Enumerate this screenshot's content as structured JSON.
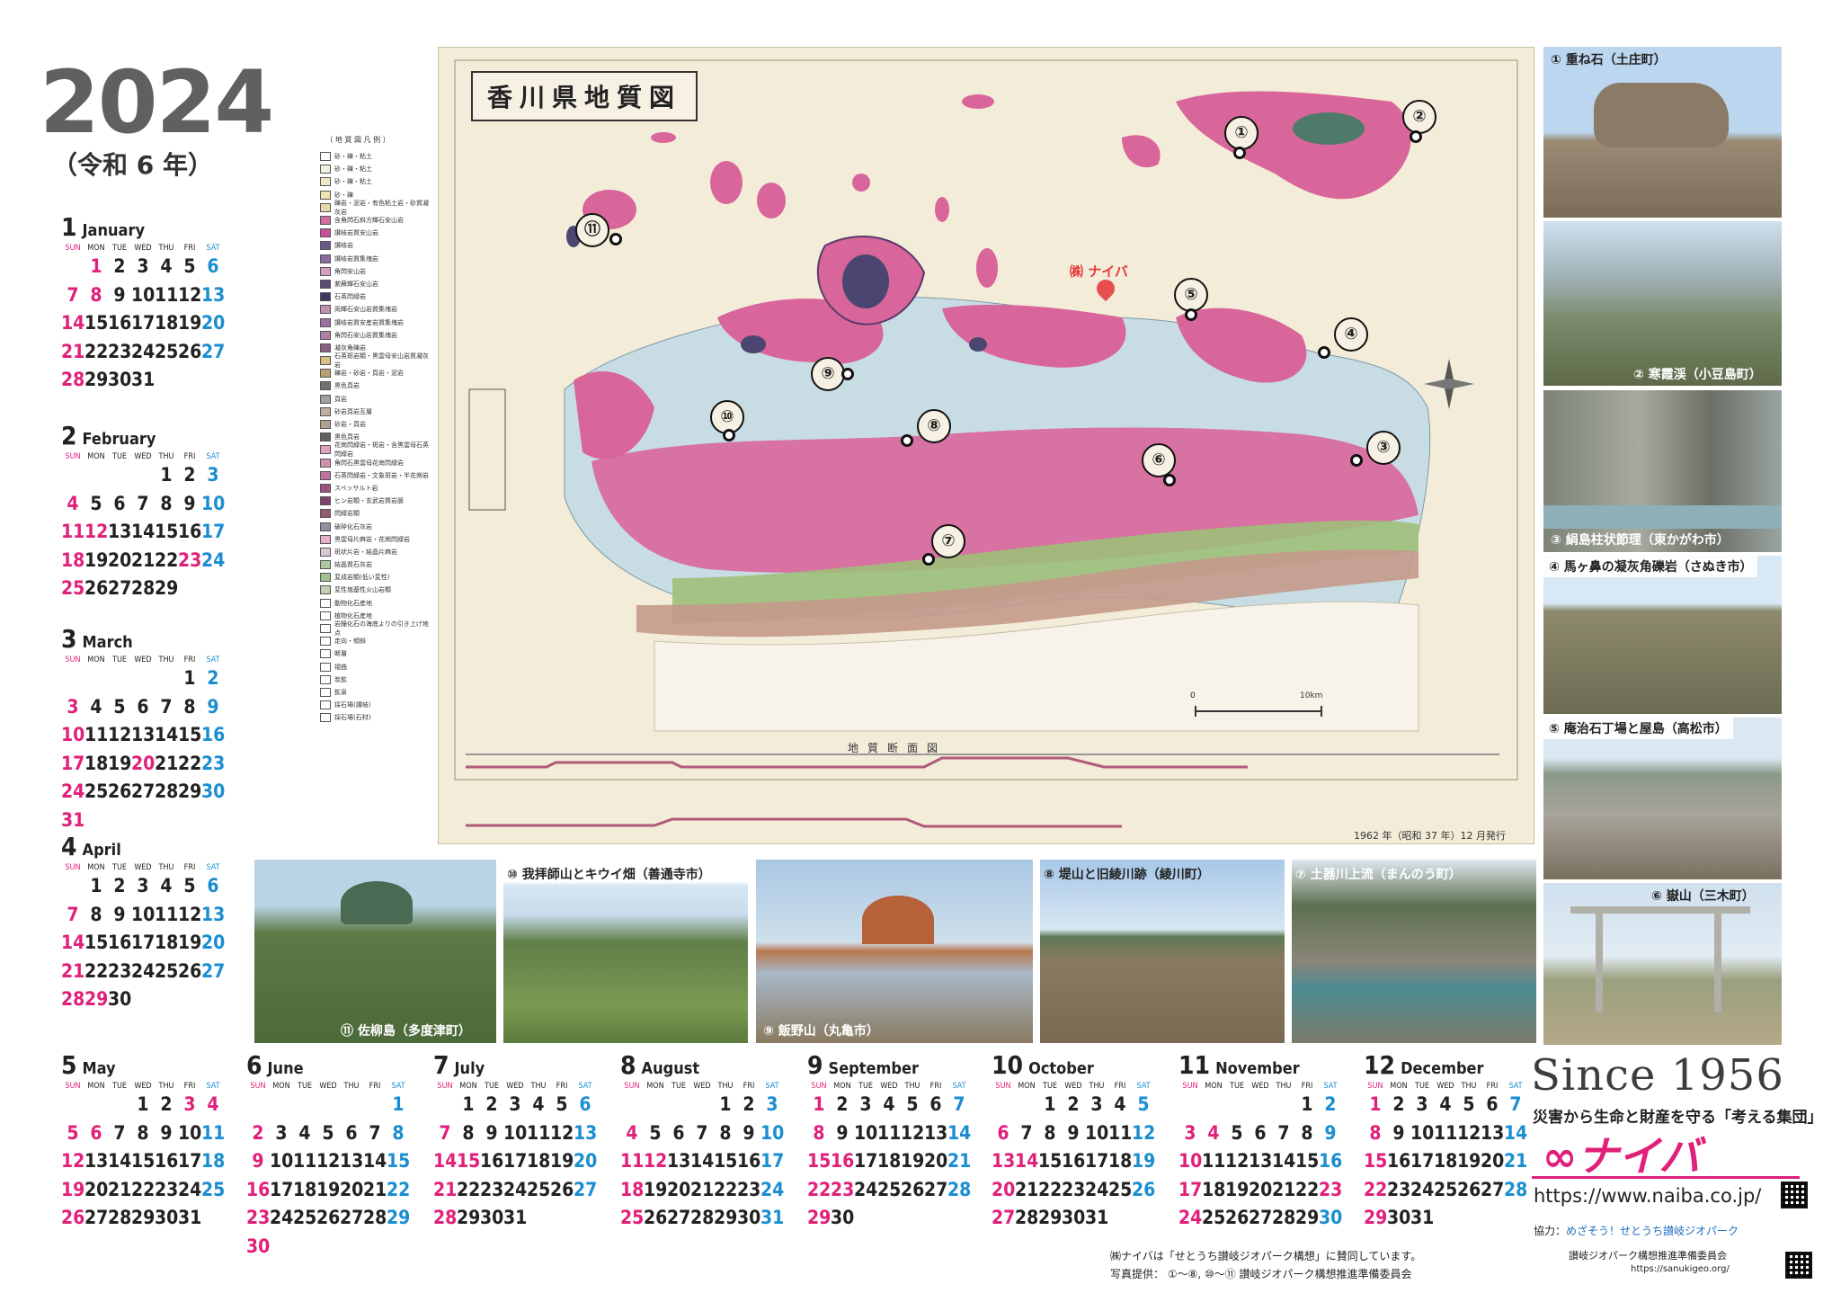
{
  "header": {
    "year": "2024",
    "era": "（令和 6 年）"
  },
  "weekday_labels": [
    "SUN",
    "MON",
    "TUE",
    "WED",
    "THU",
    "FRI",
    "SAT"
  ],
  "months": [
    {
      "num": "1",
      "name": "January",
      "start": 1,
      "days": 31,
      "holidays": [
        1,
        8
      ]
    },
    {
      "num": "2",
      "name": "February",
      "start": 4,
      "days": 29,
      "holidays": [
        11,
        12,
        23
      ]
    },
    {
      "num": "3",
      "name": "March",
      "start": 5,
      "days": 31,
      "holidays": [
        20
      ]
    },
    {
      "num": "4",
      "name": "April",
      "start": 1,
      "days": 30,
      "holidays": [
        29
      ]
    },
    {
      "num": "5",
      "name": "May",
      "start": 3,
      "days": 31,
      "holidays": [
        3,
        4,
        5,
        6
      ]
    },
    {
      "num": "6",
      "name": "June",
      "start": 6,
      "days": 30,
      "holidays": []
    },
    {
      "num": "7",
      "name": "July",
      "start": 1,
      "days": 31,
      "holidays": [
        15
      ]
    },
    {
      "num": "8",
      "name": "August",
      "start": 4,
      "days": 31,
      "holidays": [
        11,
        12
      ]
    },
    {
      "num": "9",
      "name": "September",
      "start": 0,
      "days": 30,
      "holidays": [
        16,
        22,
        23
      ]
    },
    {
      "num": "10",
      "name": "October",
      "start": 2,
      "days": 31,
      "holidays": [
        14
      ]
    },
    {
      "num": "11",
      "name": "November",
      "start": 5,
      "days": 30,
      "holidays": [
        3,
        4,
        23
      ]
    },
    {
      "num": "12",
      "name": "December",
      "start": 0,
      "days": 31,
      "holidays": []
    }
  ],
  "map": {
    "title": "香川県地質図",
    "naiba_label": "㈱ ナイバ",
    "section_title": "地質断面図",
    "scale_zero": "0",
    "scale_label": "10km",
    "issued": "1962 年（昭和 37 年）12 月発行",
    "markers": [
      "①",
      "②",
      "③",
      "④",
      "⑤",
      "⑥",
      "⑦",
      "⑧",
      "⑨",
      "⑩",
      "⑪"
    ]
  },
  "legend": {
    "title": "〔 地 質 図 凡 例 〕",
    "items": [
      "砂・礫・粘土",
      "砂・礫・粘土",
      "砂・礫・粘土",
      "砂・礫",
      "礫岩・泥岩・有色粘土岩・砂質凝灰岩",
      "含角閃石斜方輝石安山岩",
      "讃岐岩質安山岩",
      "讃岐岩",
      "讃岐岩質集塊岩",
      "角閃安山岩",
      "紫蘇輝石安山岩",
      "石英閃緑岩",
      "両輝石安山岩質集塊岩",
      "讃岐岩質安産岩質集塊岩",
      "角閃石安山岩質集塊岩",
      "凝灰角礫岩",
      "石英斑岩類・黒雲母安山岩質凝灰岩",
      "礫岩・砂岩・頁岩・泥岩",
      "黒色頁岩",
      "頁岩",
      "砂岩頁岩互層",
      "砂岩・頁岩",
      "黒色頁岩",
      "花崗閃緑岩・斑岩・含黒雲母石英閃緑岩",
      "角閃石黒雲母花崗閃緑岩",
      "石英閃緑岩・文象斑岩・半花崗岩",
      "スペッサルト岩",
      "ヒン岩類・玄武岩質岩脈",
      "閃緑岩類",
      "破砕化石灰岩",
      "黒雲母片麻岩・花崗閃緑岩",
      "斑状片岩・結晶片麻岩",
      "結晶質石灰岩",
      "変成岩類(低い変性)",
      "変性塩基性火山岩類",
      "動物化石産地",
      "植物化石産地",
      "岩鐘化石の海底よりの引き上げ地点",
      "走向・傾斜",
      "断層",
      "褶曲",
      "炭鉱",
      "鉱泉",
      "採石場(讃岐)",
      "採石場(石材)"
    ]
  },
  "photos": {
    "p1": "① 重ね石（土庄町）",
    "p2": "② 寒霞渓（小豆島町）",
    "p3": "③ 絹島柱状節理（東かがわ市）",
    "p4": "④ 馬ヶ鼻の凝灰角礫岩（さぬき市）",
    "p5": "⑤ 庵治石丁場と屋島（高松市）",
    "p6": "⑥ 嶽山（三木町）",
    "p7": "⑦ 土器川上流（まんのう町）",
    "p8": "⑧ 堤山と旧綾川跡（綾川町）",
    "p9": "⑨ 飯野山（丸亀市）",
    "p10": "⑩ 我拝師山とキウイ畑（善通寺市）",
    "p11": "⑪ 佐柳島（多度津町）"
  },
  "footer": {
    "since": "Since 1956",
    "slogan": "災害から生命と財産を守る「考える集団」",
    "brand": "∞ナイバ",
    "url": "https://www.naiba.co.jp/",
    "coop_prefix": "協力：",
    "coop_name": "めざそう！せとうち讃岐ジオパーク",
    "geo_council": "讃岐ジオパーク構想推進準備委員会",
    "geo_url": "https://sanukigeo.org/",
    "note1": "㈱ナイバは「せとうち讃岐ジオパーク構想」に賛同しています。",
    "note2": "写真提供： ①～⑧, ⑩～⑪ 讃岐ジオパーク構想推進準備委員会"
  },
  "colors": {
    "holiday": "#e0207a",
    "saturday": "#1a8ed0",
    "brand": "#e0207a",
    "map_pink": "#d8669a",
    "map_blue": "#bfd8e0"
  }
}
